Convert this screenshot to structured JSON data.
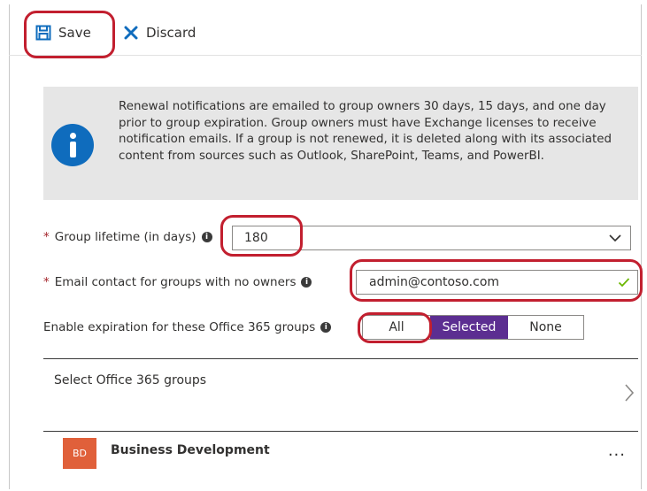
{
  "toolbar": {
    "save_label": "Save",
    "discard_label": "Discard"
  },
  "info": {
    "icon": "info-icon",
    "text": "Renewal notifications are emailed to group owners 30 days, 15 days, and one day prior to group expiration. Group owners must have Exchange licenses to receive notification emails. If a group is not renewed, it is deleted along with its associated content from sources such as Outlook, SharePoint, Teams, and PowerBI."
  },
  "form": {
    "required_mark": "*",
    "lifetime_label": "Group lifetime (in days)",
    "lifetime_value": "180",
    "email_label": "Email contact for groups with no owners",
    "email_value": "admin@contoso.com",
    "expiration_label": "Enable expiration for these Office 365 groups",
    "expiration_options": [
      "All",
      "Selected",
      "None"
    ],
    "expiration_selected": "Selected"
  },
  "select_groups": {
    "label": "Select Office 365 groups"
  },
  "groups": [
    {
      "initials": "BD",
      "name": "Business Development",
      "more": "···"
    }
  ],
  "colors": {
    "accent_purple": "#5c2e91",
    "info_blue": "#0f6cbd",
    "avatar_orange": "#e0603a",
    "callout_red": "#c21f2f",
    "valid_green": "#6bb700"
  }
}
